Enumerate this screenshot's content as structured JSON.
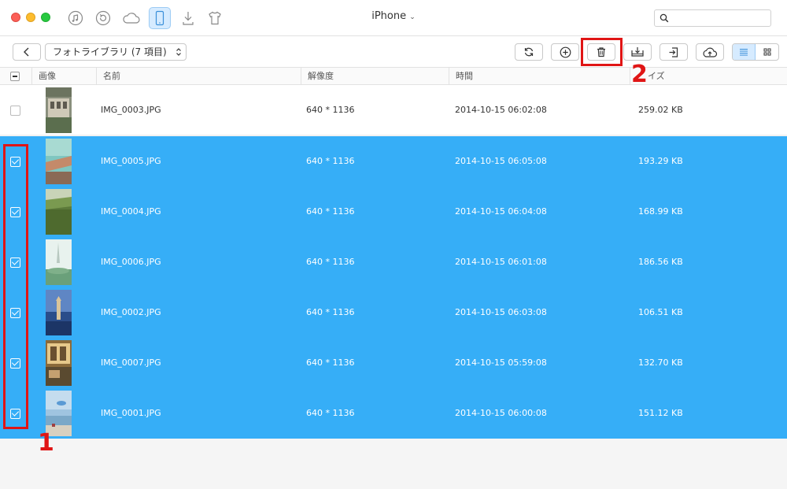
{
  "window": {
    "device_title": "iPhone"
  },
  "search": {
    "placeholder": ""
  },
  "toolbar": {
    "album_label": "フォトライブラリ (7 項目)"
  },
  "table": {
    "headers": {
      "image": "画像",
      "name": "名前",
      "resolution": "解像度",
      "time": "時間",
      "size": "イズ"
    },
    "rows": [
      {
        "name": "IMG_0003.JPG",
        "resolution": "640 * 1136",
        "time": "2014-10-15 06:02:08",
        "size": "259.02 KB",
        "selected": false
      },
      {
        "name": "IMG_0005.JPG",
        "resolution": "640 * 1136",
        "time": "2014-10-15 06:05:08",
        "size": "193.29 KB",
        "selected": true
      },
      {
        "name": "IMG_0004.JPG",
        "resolution": "640 * 1136",
        "time": "2014-10-15 06:04:08",
        "size": "168.99 KB",
        "selected": true
      },
      {
        "name": "IMG_0006.JPG",
        "resolution": "640 * 1136",
        "time": "2014-10-15 06:01:08",
        "size": "186.56 KB",
        "selected": true
      },
      {
        "name": "IMG_0002.JPG",
        "resolution": "640 * 1136",
        "time": "2014-10-15 06:03:08",
        "size": "106.51 KB",
        "selected": true
      },
      {
        "name": "IMG_0007.JPG",
        "resolution": "640 * 1136",
        "time": "2014-10-15 05:59:08",
        "size": "132.70 KB",
        "selected": true
      },
      {
        "name": "IMG_0001.JPG",
        "resolution": "640 * 1136",
        "time": "2014-10-15 06:00:08",
        "size": "151.12 KB",
        "selected": true
      }
    ]
  },
  "annotations": {
    "step1": "1",
    "step2": "2"
  },
  "icons": {
    "categories": [
      "music-icon",
      "backup-icon",
      "cloud-icon",
      "iphone-icon",
      "download-icon",
      "shirt-icon"
    ],
    "toolbar": [
      "refresh-icon",
      "add-icon",
      "trash-icon",
      "export-to-pc-icon",
      "import-icon",
      "upload-cloud-icon",
      "list-view-icon",
      "grid-view-icon"
    ]
  },
  "colors": {
    "selection": "#36aef7",
    "annotation": "#e01515",
    "active_tab": "#d6ebff"
  }
}
